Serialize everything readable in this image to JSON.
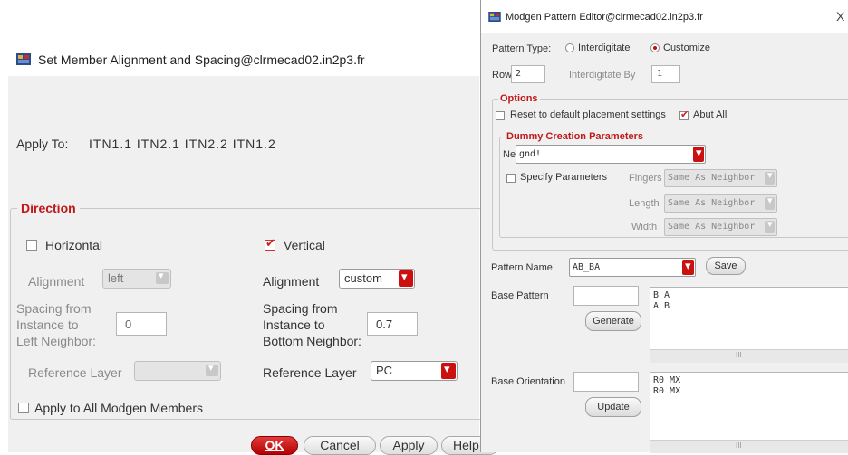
{
  "left_dialog": {
    "title": "Set Member Alignment and Spacing@clrmecad02.in2p3.fr",
    "apply_to_label": "Apply To:",
    "apply_to_value": "ITN1.1 ITN2.1 ITN2.2 ITN1.2",
    "direction_title": "Direction",
    "horizontal": {
      "label": "Horizontal",
      "checked": false,
      "alignment_label": "Alignment",
      "alignment_value": "left",
      "spacing_label_1": "Spacing from",
      "spacing_label_2": "Instance to",
      "spacing_label_3": "Left Neighbor:",
      "spacing_value": "0",
      "ref_layer_label": "Reference Layer",
      "ref_layer_value": ""
    },
    "vertical": {
      "label": "Vertical",
      "checked": true,
      "alignment_label": "Alignment",
      "alignment_value": "custom",
      "spacing_label_1": "Spacing from",
      "spacing_label_2": "Instance to",
      "spacing_label_3": "Bottom Neighbor:",
      "spacing_value": "0.7",
      "ref_layer_label": "Reference Layer",
      "ref_layer_value": "PC"
    },
    "apply_all_label": "Apply to All Modgen Members",
    "buttons": {
      "ok": "OK",
      "cancel": "Cancel",
      "apply": "Apply",
      "help": "Help"
    }
  },
  "right_dialog": {
    "title": "Modgen Pattern Editor@clrmecad02.in2p3.fr",
    "close_glyph": "X",
    "pattern_type_label": "Pattern Type:",
    "pattern_type_options": [
      "Interdigitate",
      "Customize"
    ],
    "pattern_type_selected": "Customize",
    "rows_label": "Rows",
    "rows_value": "2",
    "interdigitate_by_label": "Interdigitate By",
    "interdigitate_by_value": "1",
    "options_title": "Options",
    "reset_label": "Reset to default placement settings",
    "reset_checked": false,
    "abut_all_label": "Abut All",
    "abut_all_checked": true,
    "dummy_title": "Dummy Creation Parameters",
    "net_label": "Net",
    "net_value": "gnd!",
    "specify_params_label": "Specify Parameters",
    "specify_params_checked": false,
    "fingers_label": "Fingers",
    "fingers_value": "Same As Neighbor",
    "length_label": "Length",
    "length_value": "Same As Neighbor",
    "width_label": "Width",
    "width_value": "Same As Neighbor",
    "pattern_name_label": "Pattern Name",
    "pattern_name_value": "AB_BA",
    "save_label": "Save",
    "base_pattern_label": "Base Pattern",
    "base_pattern_lines": [
      "B A",
      "A B"
    ],
    "generate_label": "Generate",
    "base_orientation_label": "Base Orientation",
    "base_orientation_lines": [
      "R0 MX",
      "R0 MX"
    ],
    "update_label": "Update",
    "scroll_grip": "III"
  },
  "colors": {
    "accent_red": "#cc1010",
    "section_title_red": "#c01818",
    "dialog_bg": "#f0f0f0"
  }
}
